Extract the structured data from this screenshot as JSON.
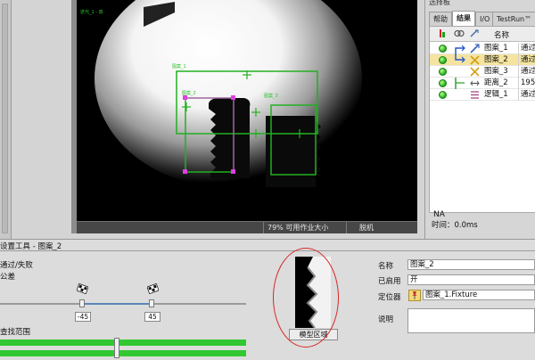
{
  "viewer": {
    "corner_text": "迭代_1 - 真",
    "labels": [
      "图案_1",
      "图案_2",
      "图案_3"
    ],
    "status_zoom": "79% 可用作业大小",
    "status_mode": "脱机"
  },
  "results_panel": {
    "title": "选择板",
    "tabs": [
      "帮助",
      "结果",
      "I/O",
      "TestRun™"
    ],
    "active_tab": "结果",
    "header_name": "名称",
    "rows": [
      {
        "icon": "pattern-icon",
        "name": "图案_1",
        "value": "通过"
      },
      {
        "icon": "pattern-icon",
        "name": "图案_2",
        "value": "通过"
      },
      {
        "icon": "pattern-icon",
        "name": "图案_3",
        "value": "通过"
      },
      {
        "icon": "distance-icon",
        "name": "距离_2",
        "value": "195."
      },
      {
        "icon": "logic-icon",
        "name": "逻辑_1",
        "value": "通过"
      }
    ],
    "footer_na": "NA",
    "footer_time": "时间：0.0ms"
  },
  "tool": {
    "title": "设置工具 - 图案_2",
    "pass_fail_label": "通过/失败",
    "tolerance_label": "公差",
    "tol_min": "-45",
    "tol_max": "45",
    "search_range_label": "查找范围",
    "pattern_button": "模型区域"
  },
  "properties": {
    "name_label": "名称",
    "name_value": "图案_2",
    "enabled_label": "已启用",
    "enabled_value": "开",
    "locator_label": "定位器",
    "locator_value": "图案_1.Fixture",
    "desc_label": "说明"
  },
  "colors": {
    "accent_green": "#32c832",
    "overlay_green": "#22b022",
    "handle_magenta": "#e040e0",
    "highlight": "#f4e4a0",
    "annotation_red": "#d82626"
  }
}
